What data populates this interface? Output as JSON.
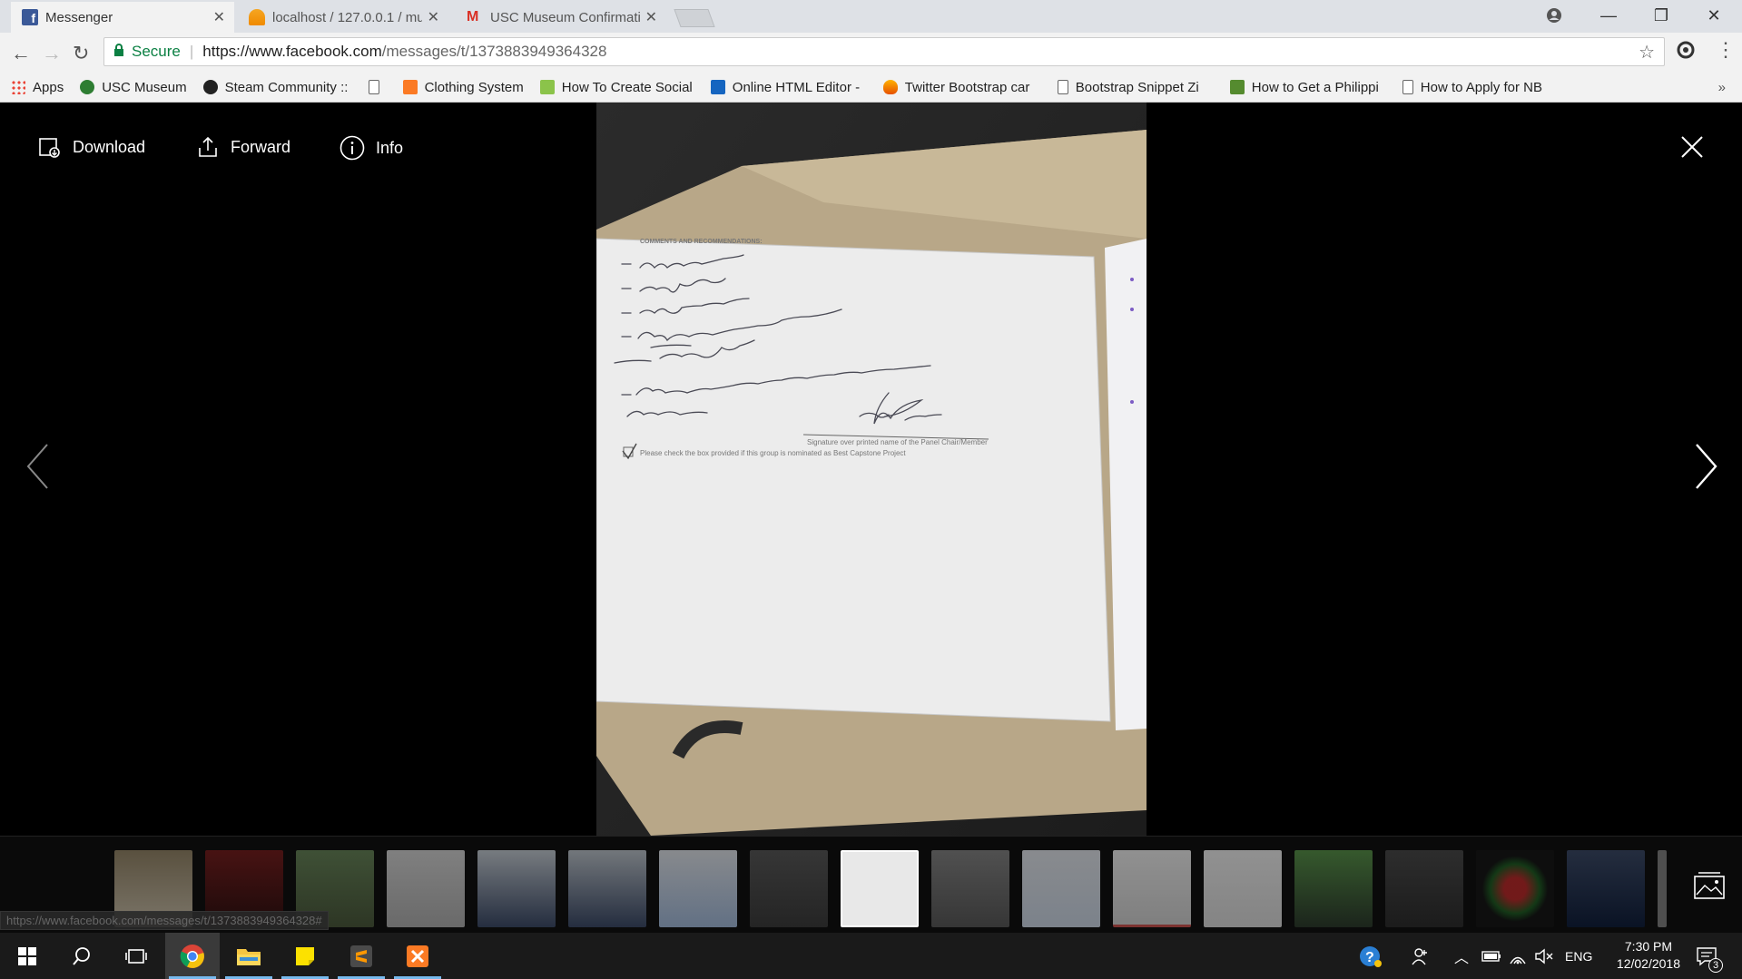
{
  "browser": {
    "tabs": [
      {
        "title": "Messenger",
        "icon": "facebook-icon",
        "active": true
      },
      {
        "title": "localhost / 127.0.0.1 / mu",
        "icon": "phpmyadmin-icon",
        "active": false
      },
      {
        "title": "USC Museum Confirmati",
        "icon": "gmail-icon",
        "active": false
      }
    ],
    "address": {
      "secure_label": "Secure",
      "url_host": "https://www.facebook.com",
      "url_path": "/messages/t/1373883949364328"
    },
    "bookmarks": [
      {
        "label": "Apps",
        "icon": "apps-grid-icon"
      },
      {
        "label": "USC Museum",
        "icon": "usc-icon"
      },
      {
        "label": "Steam Community :: G",
        "icon": "steam-icon"
      },
      {
        "label": "",
        "icon": "page-icon"
      },
      {
        "label": "Clothing System",
        "icon": "xampp-icon"
      },
      {
        "label": "How To Create Social",
        "icon": "green-logo-icon"
      },
      {
        "label": "Online HTML Editor -",
        "icon": "editor-icon"
      },
      {
        "label": "Twitter Bootstrap car",
        "icon": "fire-icon"
      },
      {
        "label": "Bootstrap Snippet Zi",
        "icon": "page-icon"
      },
      {
        "label": "How to Get a Philippi",
        "icon": "h-icon"
      },
      {
        "label": "How to Apply for NB",
        "icon": "page-icon"
      }
    ],
    "bookmarks_more": "»"
  },
  "viewer": {
    "download_label": "Download",
    "forward_label": "Forward",
    "info_label": "Info",
    "status_url": "https://www.facebook.com/messages/t/1373883949364328#"
  },
  "taskbar": {
    "language": "ENG",
    "time": "7:30 PM",
    "date": "12/02/2018",
    "notification_count": "3"
  }
}
